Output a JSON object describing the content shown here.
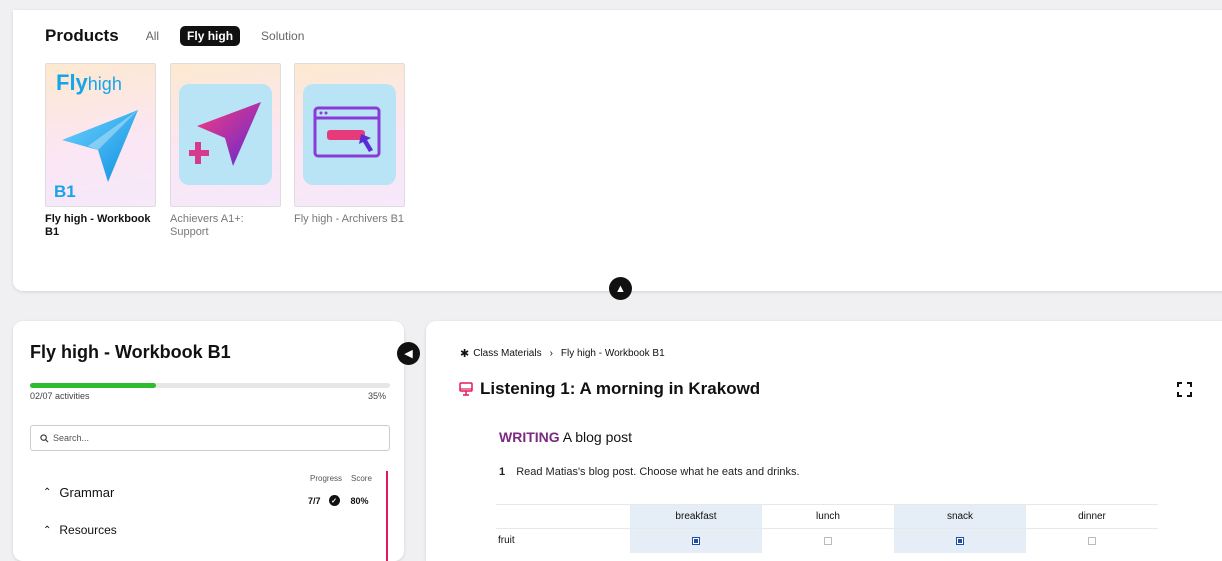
{
  "products": {
    "title": "Products",
    "filters": [
      "All",
      "Fly high",
      "Solution"
    ],
    "active_filter": "Fly high",
    "cards": [
      {
        "title": "Fly high - Workbook B1",
        "active": true,
        "cover_brand": "Fly",
        "cover_brand_suffix": "high",
        "cover_level": "B1"
      },
      {
        "title": "Achievers A1+: Support",
        "active": false
      },
      {
        "title": "Fly high - Archivers B1",
        "active": false
      }
    ]
  },
  "sidebar": {
    "title": "Fly high - Workbook B1",
    "progress_text": "02/07 activities",
    "progress_percent": "35%",
    "progress_fraction": 0.35,
    "search_placeholder": "Search...",
    "col_progress": "Progress",
    "col_score": "Score",
    "sections": [
      {
        "label": "Grammar",
        "progress": "7/7",
        "score": "80%"
      },
      {
        "label": "Resources"
      }
    ]
  },
  "content": {
    "breadcrumb": [
      "Class Materials",
      "Fly high - Workbook B1"
    ],
    "lesson_title": "Listening 1: A morning in Krakowd",
    "writing_label": "WRITING",
    "writing_subtitle": "A blog post",
    "instruction_number": "1",
    "instruction_text": "Read Matias's blog post. Choose what he eats and drinks.",
    "table": {
      "columns": [
        "breakfast",
        "lunch",
        "snack",
        "dinner"
      ],
      "rows": [
        {
          "label": "fruit",
          "checks": [
            true,
            false,
            true,
            false
          ]
        }
      ]
    }
  },
  "colors": {
    "accent_green": "#2fbb2f",
    "accent_pink": "#e2195b",
    "writing_purple": "#7a2a7f",
    "brand_blue": "#18a4e8"
  },
  "icons": [
    "chevron-up-icon",
    "chevron-left-icon",
    "search-icon",
    "puzzle-icon",
    "chevron-right-icon",
    "presentation-icon",
    "fullscreen-icon",
    "check-circle-icon"
  ]
}
